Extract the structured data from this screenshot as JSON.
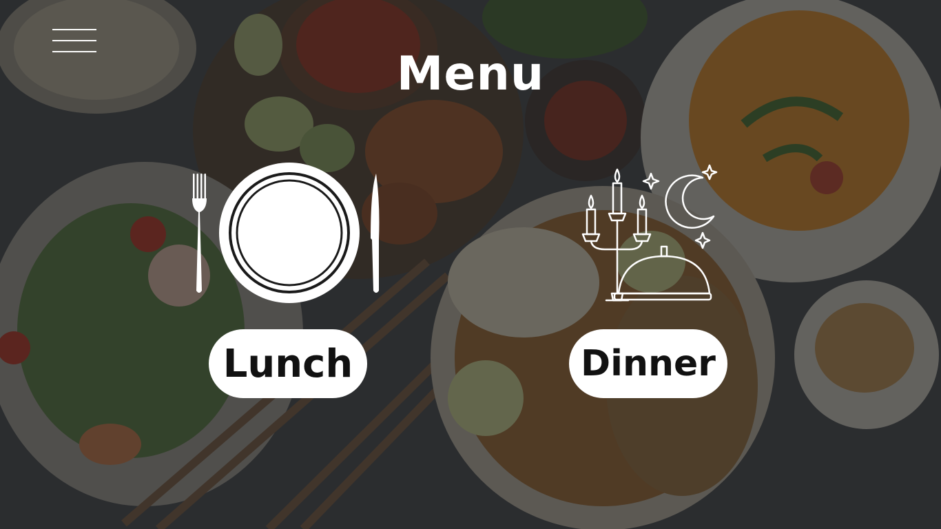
{
  "page": {
    "title": "Menu"
  },
  "header": {
    "menu_icon": "hamburger-icon"
  },
  "options": [
    {
      "label": "Lunch",
      "icon": "plate-fork-knife-icon"
    },
    {
      "label": "Dinner",
      "icon": "candelabra-cloche-moon-icon"
    }
  ],
  "colors": {
    "text": "#ffffff",
    "button_bg": "#ffffff",
    "button_text": "#111111",
    "overlay": "#1e1f21"
  }
}
